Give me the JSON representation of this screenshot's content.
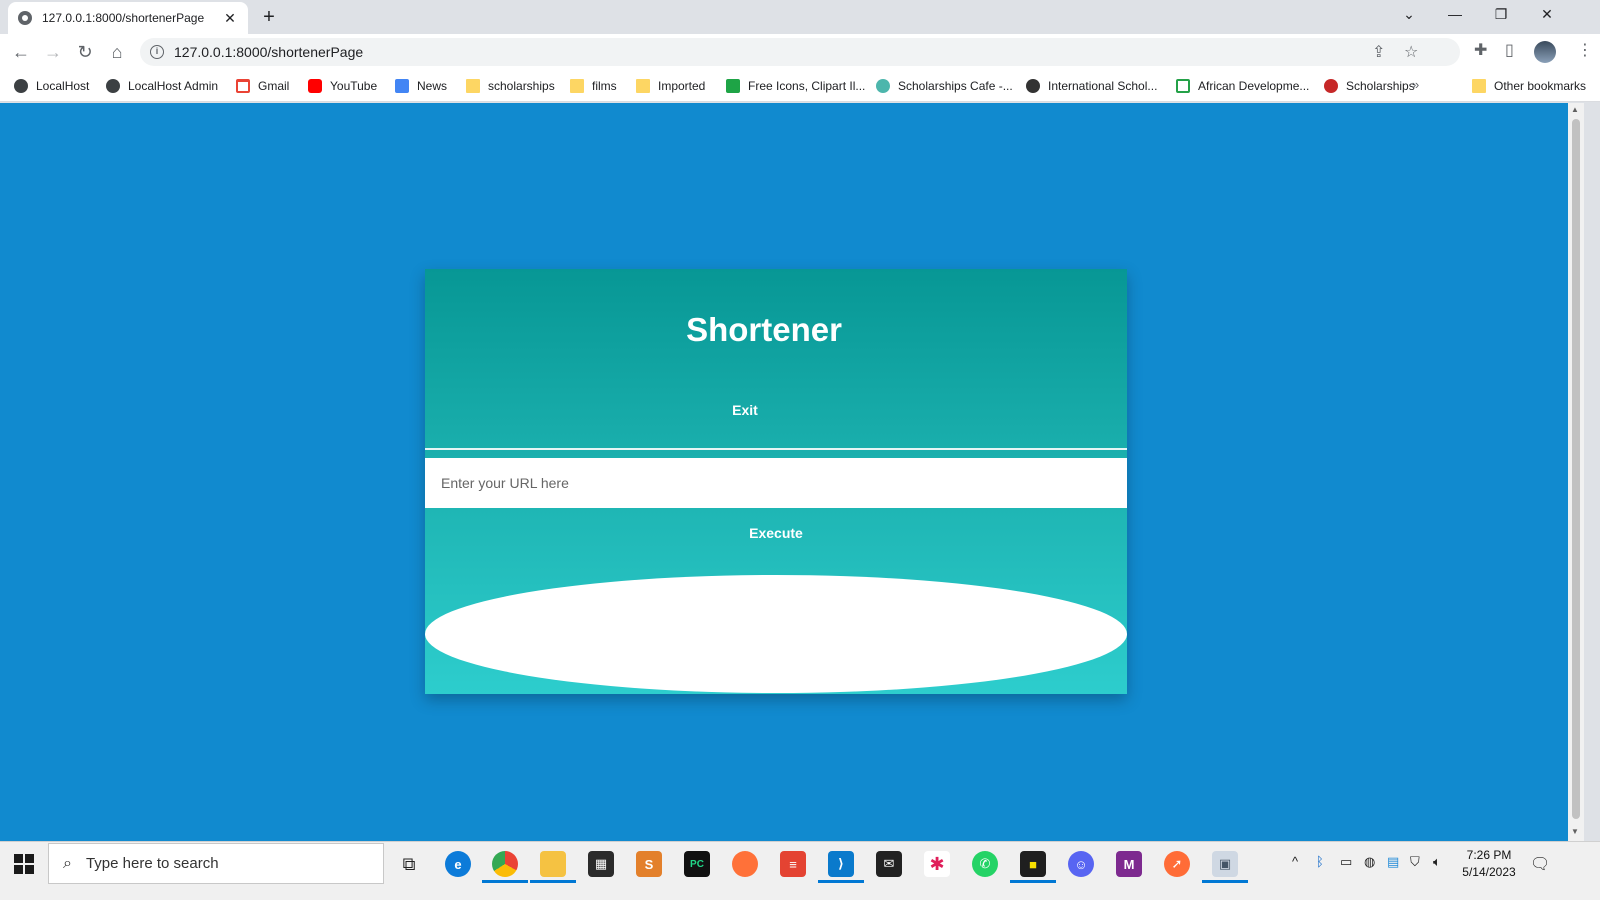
{
  "browser": {
    "tab_title": "127.0.0.1:8000/shortenerPage",
    "tab_close": "✕",
    "new_tab": "+",
    "url": "127.0.0.1:8000/shortenerPage",
    "bookmarks": [
      {
        "label": "LocalHost",
        "icon": "globe"
      },
      {
        "label": "LocalHost Admin",
        "icon": "globe"
      },
      {
        "label": "Gmail",
        "icon": "gmail"
      },
      {
        "label": "YouTube",
        "icon": "yt"
      },
      {
        "label": "News",
        "icon": "news"
      },
      {
        "label": "scholarships",
        "icon": "folder"
      },
      {
        "label": "films",
        "icon": "folder"
      },
      {
        "label": "Imported",
        "icon": "folder"
      },
      {
        "label": "Free Icons, Clipart Il...",
        "icon": "green"
      },
      {
        "label": "Scholarships Cafe -...",
        "icon": "cap"
      },
      {
        "label": "International Schol...",
        "icon": "hand"
      },
      {
        "label": "African Developme...",
        "icon": "ad"
      },
      {
        "label": "Scholarships",
        "icon": "grad"
      }
    ],
    "bookmarks_overflow": "»",
    "other_bookmarks": "Other bookmarks"
  },
  "page": {
    "title": "Shortener",
    "exit_label": "Exit",
    "url_placeholder": "Enter your URL here",
    "execute_label": "Execute",
    "background_color": "#118acf",
    "card_gradient": [
      "#079795",
      "#2dcdcd"
    ]
  },
  "taskbar": {
    "search_placeholder": "Type here to search",
    "apps": [
      "task-view",
      "edge",
      "chrome",
      "file-explorer",
      "store",
      "sublime-text",
      "pycharm",
      "firefox",
      "todoist",
      "vscode",
      "mail",
      "slack",
      "whatsapp",
      "sticky-app",
      "discord",
      "m-app",
      "postman",
      "photos"
    ],
    "time": "7:26 PM",
    "date": "5/14/2023"
  }
}
